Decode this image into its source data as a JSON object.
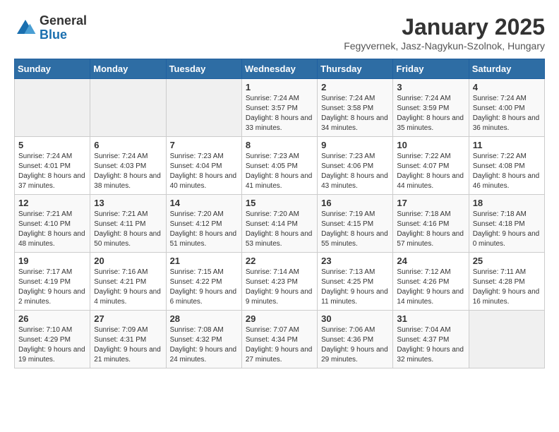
{
  "header": {
    "logo": {
      "general": "General",
      "blue": "Blue"
    },
    "title": "January 2025",
    "location": "Fegyvernek, Jasz-Nagykun-Szolnok, Hungary"
  },
  "weekdays": [
    "Sunday",
    "Monday",
    "Tuesday",
    "Wednesday",
    "Thursday",
    "Friday",
    "Saturday"
  ],
  "weeks": [
    [
      {
        "day": "",
        "info": ""
      },
      {
        "day": "",
        "info": ""
      },
      {
        "day": "",
        "info": ""
      },
      {
        "day": "1",
        "info": "Sunrise: 7:24 AM\nSunset: 3:57 PM\nDaylight: 8 hours and 33 minutes."
      },
      {
        "day": "2",
        "info": "Sunrise: 7:24 AM\nSunset: 3:58 PM\nDaylight: 8 hours and 34 minutes."
      },
      {
        "day": "3",
        "info": "Sunrise: 7:24 AM\nSunset: 3:59 PM\nDaylight: 8 hours and 35 minutes."
      },
      {
        "day": "4",
        "info": "Sunrise: 7:24 AM\nSunset: 4:00 PM\nDaylight: 8 hours and 36 minutes."
      }
    ],
    [
      {
        "day": "5",
        "info": "Sunrise: 7:24 AM\nSunset: 4:01 PM\nDaylight: 8 hours and 37 minutes."
      },
      {
        "day": "6",
        "info": "Sunrise: 7:24 AM\nSunset: 4:03 PM\nDaylight: 8 hours and 38 minutes."
      },
      {
        "day": "7",
        "info": "Sunrise: 7:23 AM\nSunset: 4:04 PM\nDaylight: 8 hours and 40 minutes."
      },
      {
        "day": "8",
        "info": "Sunrise: 7:23 AM\nSunset: 4:05 PM\nDaylight: 8 hours and 41 minutes."
      },
      {
        "day": "9",
        "info": "Sunrise: 7:23 AM\nSunset: 4:06 PM\nDaylight: 8 hours and 43 minutes."
      },
      {
        "day": "10",
        "info": "Sunrise: 7:22 AM\nSunset: 4:07 PM\nDaylight: 8 hours and 44 minutes."
      },
      {
        "day": "11",
        "info": "Sunrise: 7:22 AM\nSunset: 4:08 PM\nDaylight: 8 hours and 46 minutes."
      }
    ],
    [
      {
        "day": "12",
        "info": "Sunrise: 7:21 AM\nSunset: 4:10 PM\nDaylight: 8 hours and 48 minutes."
      },
      {
        "day": "13",
        "info": "Sunrise: 7:21 AM\nSunset: 4:11 PM\nDaylight: 8 hours and 50 minutes."
      },
      {
        "day": "14",
        "info": "Sunrise: 7:20 AM\nSunset: 4:12 PM\nDaylight: 8 hours and 51 minutes."
      },
      {
        "day": "15",
        "info": "Sunrise: 7:20 AM\nSunset: 4:14 PM\nDaylight: 8 hours and 53 minutes."
      },
      {
        "day": "16",
        "info": "Sunrise: 7:19 AM\nSunset: 4:15 PM\nDaylight: 8 hours and 55 minutes."
      },
      {
        "day": "17",
        "info": "Sunrise: 7:18 AM\nSunset: 4:16 PM\nDaylight: 8 hours and 57 minutes."
      },
      {
        "day": "18",
        "info": "Sunrise: 7:18 AM\nSunset: 4:18 PM\nDaylight: 9 hours and 0 minutes."
      }
    ],
    [
      {
        "day": "19",
        "info": "Sunrise: 7:17 AM\nSunset: 4:19 PM\nDaylight: 9 hours and 2 minutes."
      },
      {
        "day": "20",
        "info": "Sunrise: 7:16 AM\nSunset: 4:21 PM\nDaylight: 9 hours and 4 minutes."
      },
      {
        "day": "21",
        "info": "Sunrise: 7:15 AM\nSunset: 4:22 PM\nDaylight: 9 hours and 6 minutes."
      },
      {
        "day": "22",
        "info": "Sunrise: 7:14 AM\nSunset: 4:23 PM\nDaylight: 9 hours and 9 minutes."
      },
      {
        "day": "23",
        "info": "Sunrise: 7:13 AM\nSunset: 4:25 PM\nDaylight: 9 hours and 11 minutes."
      },
      {
        "day": "24",
        "info": "Sunrise: 7:12 AM\nSunset: 4:26 PM\nDaylight: 9 hours and 14 minutes."
      },
      {
        "day": "25",
        "info": "Sunrise: 7:11 AM\nSunset: 4:28 PM\nDaylight: 9 hours and 16 minutes."
      }
    ],
    [
      {
        "day": "26",
        "info": "Sunrise: 7:10 AM\nSunset: 4:29 PM\nDaylight: 9 hours and 19 minutes."
      },
      {
        "day": "27",
        "info": "Sunrise: 7:09 AM\nSunset: 4:31 PM\nDaylight: 9 hours and 21 minutes."
      },
      {
        "day": "28",
        "info": "Sunrise: 7:08 AM\nSunset: 4:32 PM\nDaylight: 9 hours and 24 minutes."
      },
      {
        "day": "29",
        "info": "Sunrise: 7:07 AM\nSunset: 4:34 PM\nDaylight: 9 hours and 27 minutes."
      },
      {
        "day": "30",
        "info": "Sunrise: 7:06 AM\nSunset: 4:36 PM\nDaylight: 9 hours and 29 minutes."
      },
      {
        "day": "31",
        "info": "Sunrise: 7:04 AM\nSunset: 4:37 PM\nDaylight: 9 hours and 32 minutes."
      },
      {
        "day": "",
        "info": ""
      }
    ]
  ]
}
